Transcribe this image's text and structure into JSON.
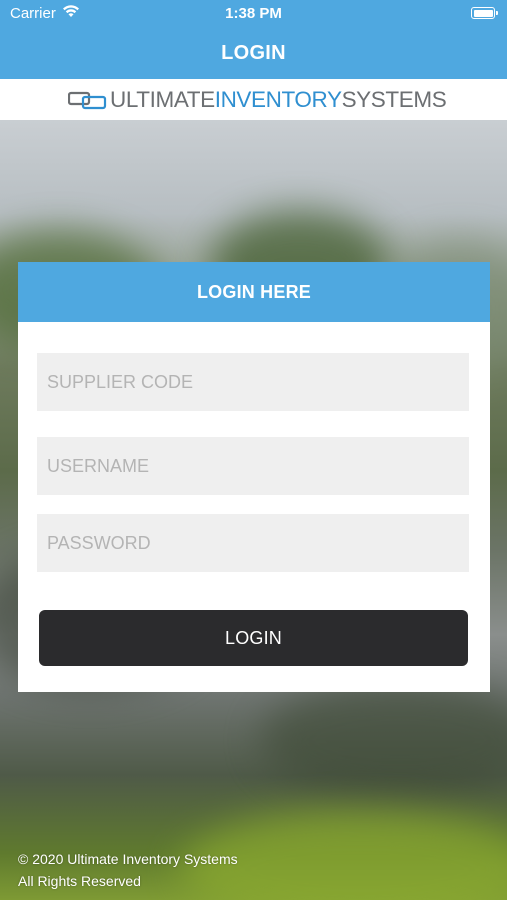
{
  "status_bar": {
    "carrier": "Carrier",
    "time": "1:38 PM"
  },
  "nav": {
    "title": "LOGIN"
  },
  "logo": {
    "part1": "ULTIMATE",
    "part2": "INVENTORY",
    "part3": "SYSTEMS"
  },
  "card": {
    "header": "LOGIN HERE",
    "supplier_code_placeholder": "SUPPLIER CODE",
    "username_placeholder": "USERNAME",
    "password_placeholder": "PASSWORD",
    "login_button": "LOGIN"
  },
  "footer": {
    "copyright": "© 2020 Ultimate Inventory Systems",
    "rights": "All Rights Reserved"
  },
  "colors": {
    "accent": "#4fa8e0",
    "button": "#2b2b2d",
    "logo_blue": "#2f8fd0",
    "logo_grey": "#6c6f72"
  }
}
